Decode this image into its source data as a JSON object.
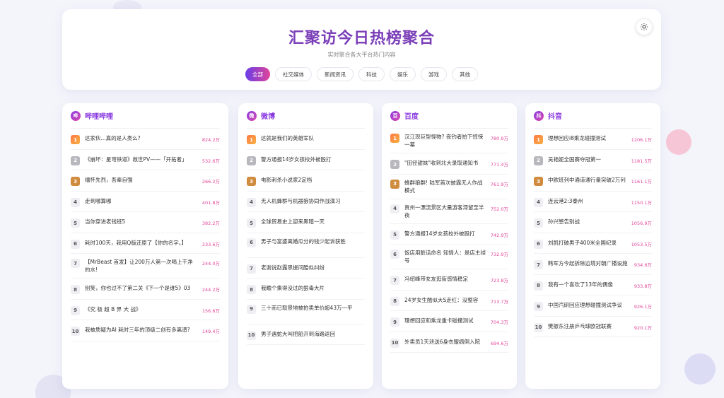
{
  "header": {
    "title": "汇聚访今日热榜聚合",
    "subtitle": "实时聚合各大平台热门内容",
    "tabs": [
      "全部",
      "社交媒体",
      "新闻资讯",
      "科技",
      "娱乐",
      "游戏",
      "其他"
    ],
    "active_tab": "全部"
  },
  "colors": {
    "accent": "#8a3be0",
    "accent2": "#e0459a",
    "heat": "#e0459a"
  },
  "cards": [
    {
      "name": "哔哩哔哩",
      "logo": "哔",
      "items": [
        {
          "rank": "1",
          "title": "这家伙...真的是人类么?",
          "heat": "824.2万"
        },
        {
          "rank": "2",
          "title": "《崩坏：星穹铁道》救世PV——「开拓者」",
          "heat": "532.6万"
        },
        {
          "rank": "3",
          "title": "缅怀先烈，吾辈自强",
          "heat": "266.2万"
        },
        {
          "rank": "4",
          "title": "走到哪算哪",
          "heat": "401.8万"
        },
        {
          "rank": "5",
          "title": "当你穿进老钱班5",
          "heat": "382.2万"
        },
        {
          "rank": "6",
          "title": "耗时100天，我用Q版还原了【你的名字。】",
          "heat": "233.6万"
        },
        {
          "rank": "7",
          "title": "【MrBeast 首发】让200万人第一次喝上干净的水!",
          "heat": "244.0万"
        },
        {
          "rank": "8",
          "title": "别笑，你也过不了第二关《下一个是谁5》03",
          "heat": "244.2万"
        },
        {
          "rank": "9",
          "title": "《究 极 超 B 界 大 战》",
          "heat": "156.6万"
        },
        {
          "rank": "10",
          "title": "我被质疑为AI 耗时三年的顶级二创有多离谱?",
          "heat": "149.4万"
        }
      ]
    },
    {
      "name": "微博",
      "logo": "微",
      "items": [
        {
          "rank": "1",
          "title": "这就是我们的英雄军队",
          "heat": ""
        },
        {
          "rank": "2",
          "title": "警方通报14岁女孩校外被殴打",
          "heat": ""
        },
        {
          "rank": "3",
          "title": "电影刺杀小说家2定档",
          "heat": ""
        },
        {
          "rank": "4",
          "title": "无人机蜂群与机器狼协同作战演习",
          "heat": ""
        },
        {
          "rank": "5",
          "title": "全球贸易史上迎来黑暗一天",
          "heat": ""
        },
        {
          "rank": "6",
          "title": "男子与富婆离婚瓜分的钱少起诉获胜",
          "heat": ""
        },
        {
          "rank": "7",
          "title": "老谢说赵露思提问酷似纠纷",
          "heat": ""
        },
        {
          "rank": "8",
          "title": "我瞻个乘得没过的狠毒大片",
          "heat": ""
        },
        {
          "rank": "9",
          "title": "三十而已取景地被拍卖单价超43万一平",
          "heat": ""
        },
        {
          "rank": "10",
          "title": "男子遇蛇大叫把船开到海路返回",
          "heat": ""
        }
      ]
    },
    {
      "name": "百度",
      "logo": "百",
      "items": [
        {
          "rank": "1",
          "title": "汉江现巨型怪物? 夜钓者拍下惊悚一幕",
          "heat": "780.9万"
        },
        {
          "rank": "2",
          "title": "\"田径甜妹\"收到北大录取通知书",
          "heat": "771.4万"
        },
        {
          "rank": "3",
          "title": "蜂群狼群! 陆军首次披露无人作战模式",
          "heat": "761.9万"
        },
        {
          "rank": "4",
          "title": "贵州一漂流景区大量游客滞留至半夜",
          "heat": "752.0万"
        },
        {
          "rank": "5",
          "title": "警方通报14岁女孩校外被殴打",
          "heat": "742.9万"
        },
        {
          "rank": "6",
          "title": "饭店用脏话命名 知情人：是店主绰号",
          "heat": "732.9万"
        },
        {
          "rank": "7",
          "title": "冯绍峰带女友逛街感情稳定",
          "heat": "723.8万"
        },
        {
          "rank": "8",
          "title": "24岁女生酷似大S走红：没整容",
          "heat": "713.7万"
        },
        {
          "rank": "9",
          "title": "理想回应和乘龙重卡碰撞测试",
          "heat": "704.3万"
        },
        {
          "rank": "10",
          "title": "外卖员1天泄送6身衣服病倒入院",
          "heat": "694.6万"
        }
      ]
    },
    {
      "name": "抖音",
      "logo": "抖",
      "items": [
        {
          "rank": "1",
          "title": "理想回应i8乘龙碰撞测试",
          "heat": "1206.1万"
        },
        {
          "rank": "2",
          "title": "吴艳妮全国赛夺冠第一",
          "heat": "1181.5万"
        },
        {
          "rank": "3",
          "title": "中欧班列中通道通行量突破2万列",
          "heat": "1161.1万"
        },
        {
          "rank": "4",
          "title": "连云港2:3泰州",
          "heat": "1150.1万"
        },
        {
          "rank": "5",
          "title": "孙兴慜告别战",
          "heat": "1056.9万"
        },
        {
          "rank": "6",
          "title": "刘凯打破男子400米全国纪录",
          "heat": "1053.5万"
        },
        {
          "rank": "7",
          "title": "韩军方今起拆除边境对朝广播设施",
          "heat": "934.6万"
        },
        {
          "rank": "8",
          "title": "我有一个喜欢了13年的偶像",
          "heat": "933.8万"
        },
        {
          "rank": "9",
          "title": "中国汽研回应理想碰撞测试争议",
          "heat": "926.1万"
        },
        {
          "rank": "10",
          "title": "樊振东注册乒乓球欧冠联赛",
          "heat": "920.1万"
        }
      ]
    }
  ]
}
